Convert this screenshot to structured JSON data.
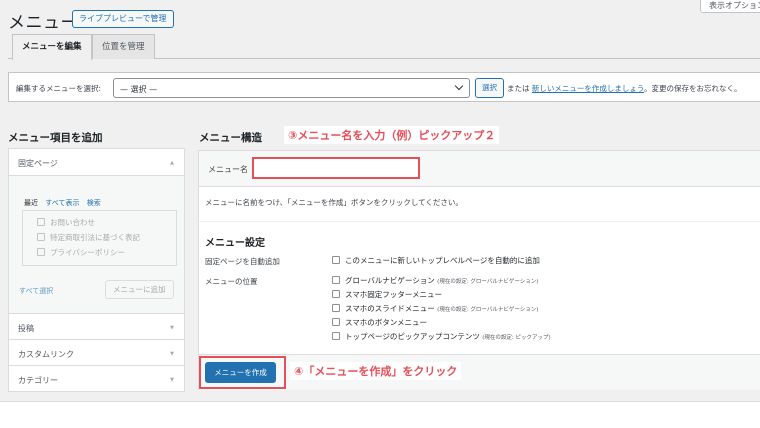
{
  "screen_options_label": "表示オプション",
  "page_title": "メニュー",
  "live_preview_button": "ライブプレビューで管理",
  "tabs": [
    {
      "label": "メニューを編集",
      "active": true
    },
    {
      "label": "位置を管理",
      "active": false
    }
  ],
  "menu_select": {
    "label": "編集するメニューを選択:",
    "selected_value": "— 選択 —",
    "select_button": "選択",
    "or_text": "または",
    "create_link": "新しいメニューを作成しましょう",
    "after_text": "。変更の保存をお忘れなく。"
  },
  "add_items": {
    "title": "メニュー項目を追加",
    "fixed_pages_label": "固定ページ",
    "subtabs": [
      "最近",
      "すべて表示",
      "検索"
    ],
    "pages": [
      "お問い合わせ",
      "特定商取引法に基づく表記",
      "プライバシーポリシー"
    ],
    "select_all": "すべて選択",
    "add_button": "メニューに追加",
    "sections": [
      "投稿",
      "カスタムリンク",
      "カテゴリー"
    ]
  },
  "structure": {
    "title": "メニュー構造",
    "name_label": "メニュー名",
    "name_value": "",
    "description": "メニューに名前をつけ、「メニューを作成」ボタンをクリックしてください。",
    "settings_title": "メニュー設定",
    "auto_add_label": "固定ページを自動追加",
    "auto_add_option": "このメニューに新しいトップレベルページを自動的に追加",
    "location_label": "メニューの位置",
    "locations": [
      {
        "label": "グローバルナビゲーション",
        "note": "(現在の設定: グローバルナビゲーション)"
      },
      {
        "label": "スマホ固定フッターメニュー",
        "note": ""
      },
      {
        "label": "スマホのスライドメニュー",
        "note": "(現在の設定: グローバルナビゲーション)"
      },
      {
        "label": "スマホのボタンメニュー",
        "note": ""
      },
      {
        "label": "トップページのピックアップコンテンツ",
        "note": "(現在の設定: ピックアップ)"
      }
    ],
    "create_button": "メニューを作成"
  },
  "annotations": {
    "step3": "③メニュー名を入力（例）ピックアップ２",
    "step4": "④「メニューを作成」をクリック"
  },
  "colors": {
    "primary_blue": "#2271b1",
    "annotation_red": "#e54f57",
    "background": "#f0f0f1"
  }
}
